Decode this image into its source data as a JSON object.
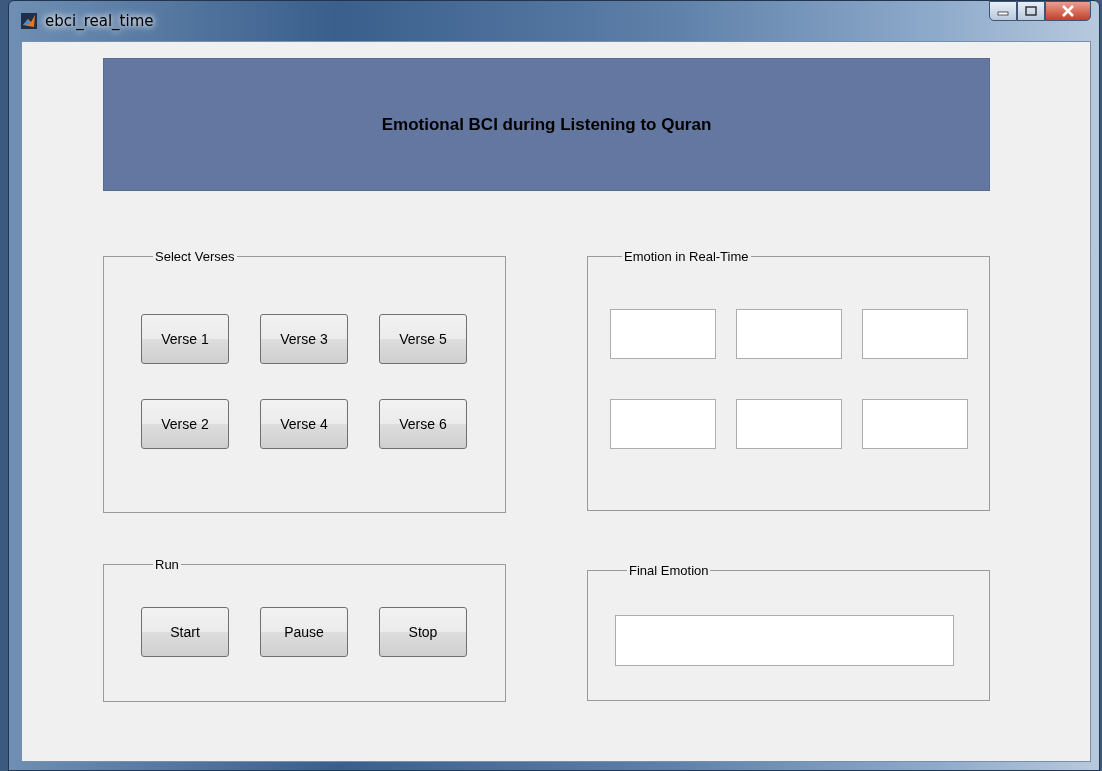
{
  "window": {
    "title": "ebci_real_time"
  },
  "banner": {
    "title": "Emotional BCI during Listening to Quran"
  },
  "select_verses": {
    "title": "Select Verses",
    "buttons": [
      "Verse 1",
      "Verse 3",
      "Verse 5",
      "Verse 2",
      "Verse 4",
      "Verse 6"
    ]
  },
  "emotion_real_time": {
    "title": "Emotion in Real-Time"
  },
  "run": {
    "title": "Run",
    "buttons": [
      "Start",
      "Pause",
      "Stop"
    ]
  },
  "final_emotion": {
    "title": "Final Emotion"
  }
}
